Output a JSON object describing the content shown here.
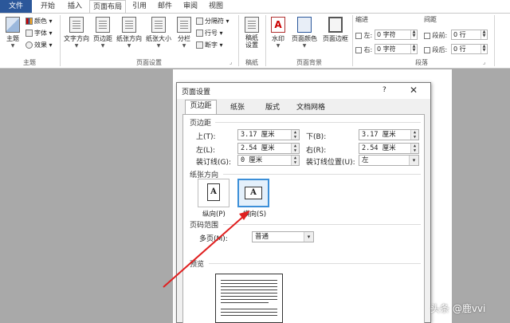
{
  "tabs": [
    "文件",
    "开始",
    "插入",
    "页面布局",
    "引用",
    "邮件",
    "审阅",
    "视图"
  ],
  "ribbon": {
    "theme": {
      "main": "主题",
      "colors": "颜色",
      "fonts": "字体",
      "effects": "效果",
      "group": "主题"
    },
    "page_setup": {
      "text_direction": "文字方向",
      "margins": "页边距",
      "orientation": "纸张方向",
      "size": "纸张大小",
      "columns": "分栏",
      "breaks": "分隔符",
      "line_numbers": "行号",
      "hyphenation": "断字",
      "group": "页面设置"
    },
    "draft": {
      "label1": "稿纸",
      "label2": "设置",
      "group": "稿纸"
    },
    "background": {
      "watermark": "水印",
      "page_color": "页面颜色",
      "page_borders": "页面边框",
      "group": "页面背景"
    },
    "paragraph": {
      "indent_title": "缩进",
      "spacing_title": "间距",
      "left": "左:",
      "right": "右:",
      "before": "段前:",
      "after": "段后:",
      "left_val": "0 字符",
      "right_val": "0 字符",
      "before_val": "0 行",
      "after_val": "0 行",
      "group": "段落"
    }
  },
  "dialog": {
    "title": "页面设置",
    "help": "?",
    "tabs": [
      "页边距",
      "纸张",
      "版式",
      "文档网格"
    ],
    "margins_section": "页边距",
    "top_label": "上(T):",
    "top_val": "3.17 厘米",
    "bottom_label": "下(B):",
    "bottom_val": "3.17 厘米",
    "left_label": "左(L):",
    "left_val": "2.54 厘米",
    "right_label": "右(R):",
    "right_val": "2.54 厘米",
    "gutter_label": "装订线(G):",
    "gutter_val": "0 厘米",
    "gutter_pos_label": "装订线位置(U):",
    "gutter_pos_val": "左",
    "orientation_section": "纸张方向",
    "portrait": "纵向(P)",
    "landscape": "横向(S)",
    "pages_section": "页码范围",
    "multiple_pages_label": "多页(M):",
    "multiple_pages_val": "普通",
    "preview_section": "预览"
  },
  "watermark": "头条 @鹿vvi",
  "colors": {
    "file_tab": "#2b579a",
    "arrow": "#e02020",
    "selected": "#3c8fd8"
  }
}
